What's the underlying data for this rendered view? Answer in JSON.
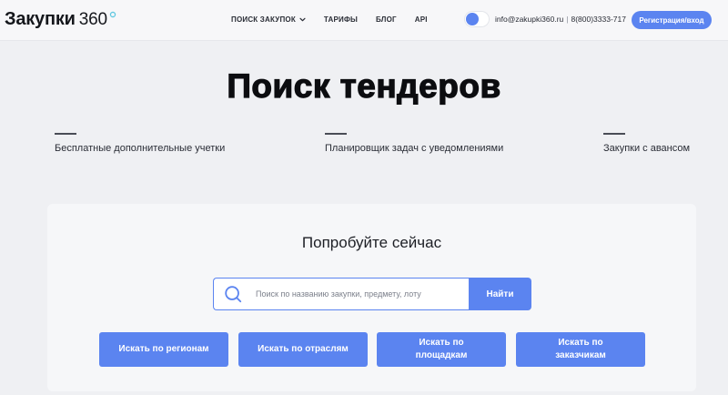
{
  "header": {
    "logo": {
      "text": "Закупки",
      "number": "360",
      "mark_color": "#5fc7e0"
    },
    "nav": [
      {
        "label": "ПОИСК ЗАКУПОК",
        "has_dropdown": true,
        "icon": "chevron-down-icon"
      },
      {
        "label": "ТАРИФЫ"
      },
      {
        "label": "БЛОГ"
      },
      {
        "label": "API"
      }
    ],
    "theme_toggle": {
      "state": "off"
    },
    "contact": {
      "email": "info@zakupki360.ru",
      "separator": "|",
      "phone": "8(800)3333-717"
    },
    "login_label": "Регистрация/вход"
  },
  "hero": {
    "title": "Поиск тендеров",
    "features": [
      {
        "text": "Бесплатные дополнительные учетки"
      },
      {
        "text": "Планировщик задач с уведомлениями"
      },
      {
        "text": "Закупки с авансом"
      }
    ]
  },
  "search_panel": {
    "title": "Попробуйте сейчас",
    "search": {
      "placeholder": "Поиск по названию закупки, предмету, лоту",
      "value": "",
      "icon": "search-icon",
      "button_label": "Найти"
    },
    "category_buttons": [
      {
        "label": "Искать по регионам"
      },
      {
        "label": "Искать по отраслям"
      },
      {
        "label": "Искать по площадкам"
      },
      {
        "label": "Искать по заказчикам"
      }
    ]
  },
  "colors": {
    "accent": "#5b84f0",
    "page_background": "#eff0f3",
    "header_background": "#f7f7f9",
    "panel_background": "#f6f7f9",
    "text_dark": "#0c0d10"
  }
}
